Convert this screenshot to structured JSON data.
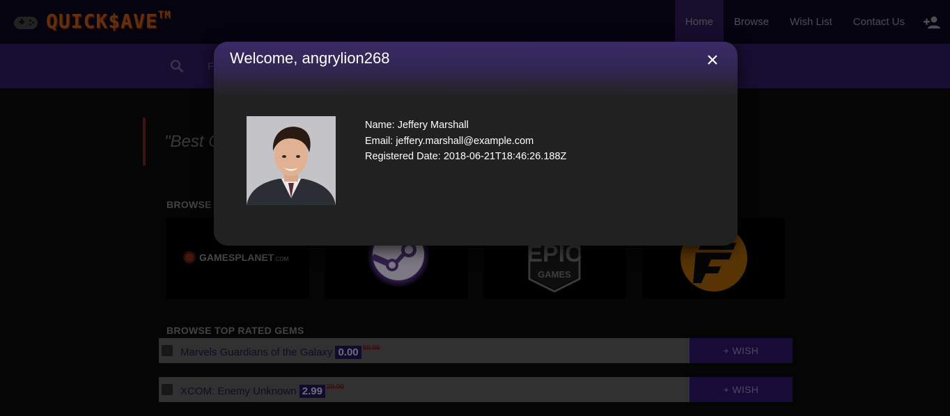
{
  "header": {
    "logo_text": "QUICK$AVE",
    "logo_tm": "TM",
    "nav": [
      {
        "label": "Home",
        "active": true
      },
      {
        "label": "Browse",
        "active": false
      },
      {
        "label": "Wish List",
        "active": false
      },
      {
        "label": "Contact Us",
        "active": false
      }
    ],
    "add_user_icon": "person-add-icon"
  },
  "search": {
    "placeholder": "F"
  },
  "quote": {
    "text": "\"Best G"
  },
  "browse_stores": {
    "title": "BROWSE F",
    "stores": [
      {
        "name": "GAMESPLANET",
        "suffix": ".COM"
      },
      {
        "name": "Steam",
        "icon": "steam-logo"
      },
      {
        "name": "EPIC GAMES",
        "top": "EPIC",
        "bottom": "GAMES"
      },
      {
        "name": "Fanatical",
        "icon": "fanatical-logo"
      }
    ]
  },
  "top_rated": {
    "title": "BROWSE TOP RATED GEMS",
    "games": [
      {
        "platform": "epic",
        "title": "Marvels Guardians of the Galaxy",
        "price": "0.00",
        "old_price": "59.99",
        "wish_label": "+ WISH"
      },
      {
        "platform": "steam",
        "title": "XCOM: Enemy Unknown",
        "price": "2.99",
        "old_price": "29.99",
        "wish_label": "+ WISH"
      }
    ]
  },
  "modal": {
    "title": "Welcome, angrylion268",
    "close_icon": "close-icon",
    "name_line": "Name: Jeffery Marshall",
    "email_line": "Email: jeffery.marshall@example.com",
    "registered_line": "Registered Date: 2018-06-21T18:46:26.188Z"
  },
  "colors": {
    "nav_bg": "#0c0620",
    "band_bg": "#2b1a5c",
    "wish_bg": "#2e1466",
    "price_bg": "#231455"
  }
}
